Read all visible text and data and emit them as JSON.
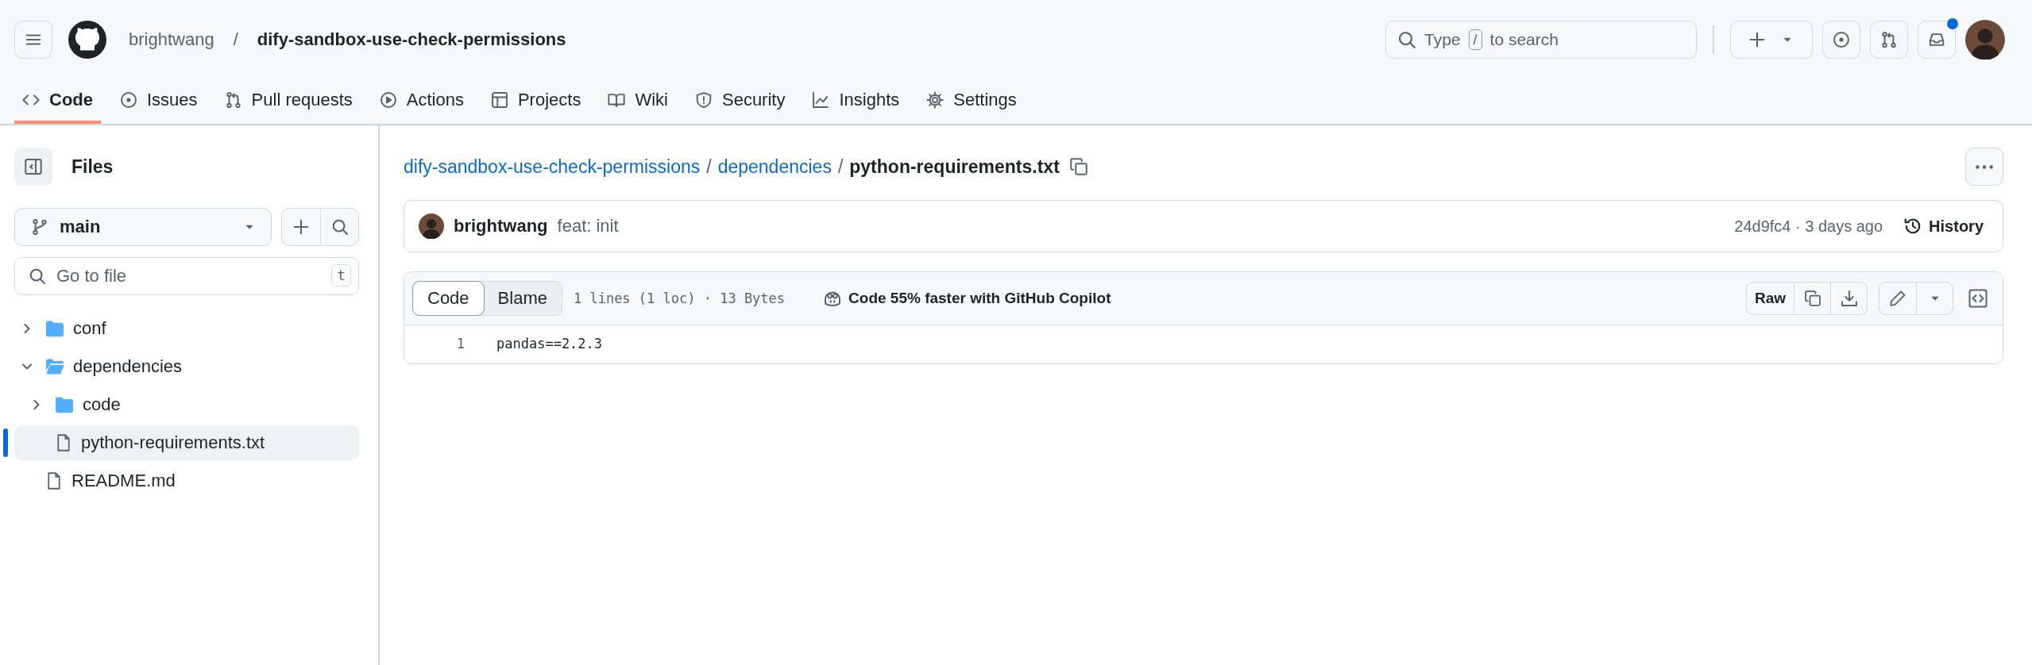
{
  "header": {
    "owner": "brightwang",
    "separator": "/",
    "repo": "dify-sandbox-use-check-permissions",
    "search": {
      "text": "Type",
      "key": "/",
      "text_after": "to search"
    },
    "inbox_unread": true
  },
  "tabs": [
    {
      "label": "Code",
      "selected": true
    },
    {
      "label": "Issues",
      "selected": false
    },
    {
      "label": "Pull requests",
      "selected": false
    },
    {
      "label": "Actions",
      "selected": false
    },
    {
      "label": "Projects",
      "selected": false
    },
    {
      "label": "Wiki",
      "selected": false
    },
    {
      "label": "Security",
      "selected": false
    },
    {
      "label": "Insights",
      "selected": false
    },
    {
      "label": "Settings",
      "selected": false
    }
  ],
  "sidebar": {
    "title": "Files",
    "branch": "main",
    "file_search": {
      "placeholder": "Go to file",
      "shortcut": "t"
    },
    "tree": [
      {
        "kind": "folder",
        "name": "conf",
        "expanded": false,
        "selected": false
      },
      {
        "kind": "folder",
        "name": "dependencies",
        "expanded": true,
        "selected": false,
        "children": [
          {
            "kind": "folder",
            "name": "code",
            "expanded": false,
            "selected": false
          },
          {
            "kind": "file",
            "name": "python-requirements.txt",
            "selected": true
          }
        ]
      },
      {
        "kind": "file",
        "name": "README.md",
        "selected": false
      }
    ]
  },
  "breadcrumb": [
    {
      "kind": "link",
      "text": "dify-sandbox-use-check-permissions"
    },
    {
      "kind": "separator",
      "text": "/"
    },
    {
      "kind": "link",
      "text": "dependencies"
    },
    {
      "kind": "separator",
      "text": "/"
    },
    {
      "kind": "current",
      "text": "python-requirements.txt"
    }
  ],
  "commit": {
    "author": "brightwang",
    "message": "feat: init",
    "meta": "24d9fc4 · 3 days ago",
    "history": "History"
  },
  "file_view": {
    "view_tabs": [
      {
        "label": "Code",
        "selected": true
      },
      {
        "label": "Blame",
        "selected": false
      }
    ],
    "stats": "1 lines (1 loc) · 13 Bytes",
    "copilot": "Code 55% faster with GitHub Copilot",
    "raw": "Raw",
    "lines": [
      {
        "number": "1",
        "text": "pandas==2.2.3"
      }
    ]
  }
}
